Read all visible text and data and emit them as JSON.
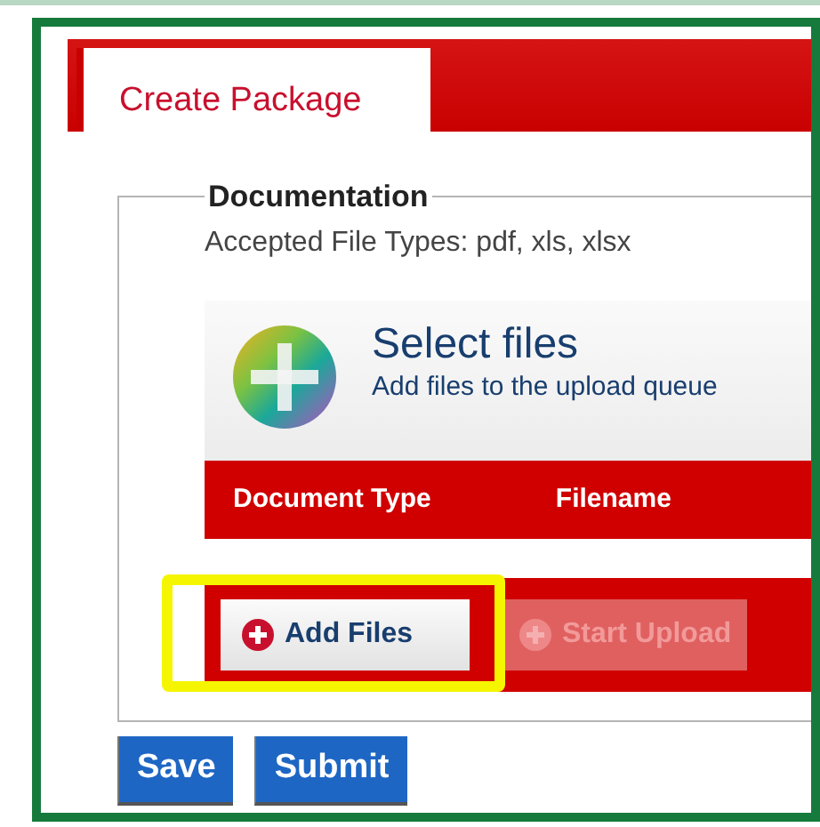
{
  "tabs": [
    {
      "label": "Create Package",
      "selected": true
    }
  ],
  "section": {
    "legend": "Documentation",
    "note": "Accepted File Types: pdf, xls, xlsx"
  },
  "uploader": {
    "title": "Select files",
    "subtitle": "Add files to the upload queue",
    "columns": [
      "Document Type",
      "Filename"
    ],
    "actions": [
      {
        "label": "Add Files",
        "disabled": false,
        "highlighted": true
      },
      {
        "label": "Start Upload",
        "disabled": true,
        "highlighted": false
      }
    ]
  },
  "buttons": [
    "Save",
    "Submit"
  ]
}
